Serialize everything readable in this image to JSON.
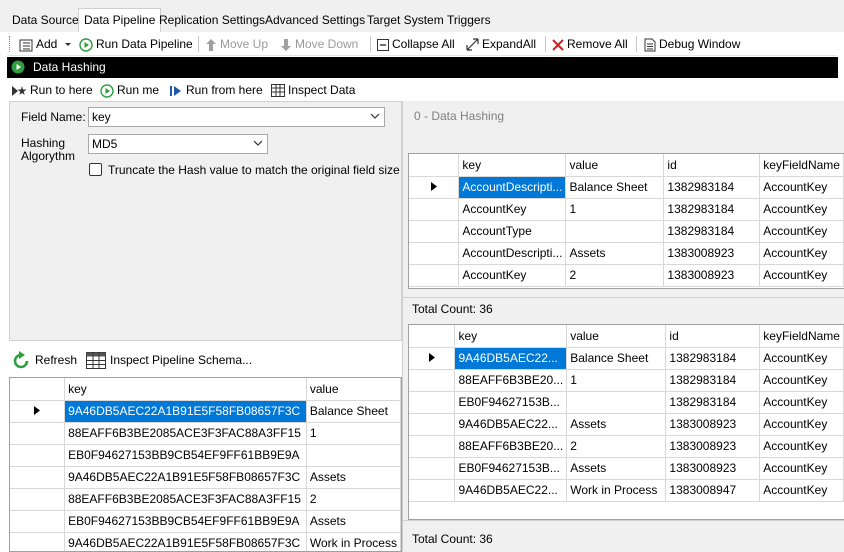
{
  "tabs": [
    {
      "label": "Data Source"
    },
    {
      "label": "Data Pipeline",
      "active": true
    },
    {
      "label": "Replication Settings"
    },
    {
      "label": "Advanced Settings"
    },
    {
      "label": "Target System"
    },
    {
      "label": "Triggers"
    }
  ],
  "toolbar": {
    "add": "Add",
    "run_pipeline": "Run Data Pipeline",
    "move_up": "Move Up",
    "move_down": "Move Down",
    "collapse_all": "Collapse All",
    "expand_all": "ExpandAll",
    "remove_all": "Remove All",
    "debug_window": "Debug Window"
  },
  "step": {
    "title": "Data Hashing"
  },
  "runbar": {
    "run_to_here": "Run to here",
    "run_me": "Run me",
    "run_from_here": "Run from here",
    "inspect_data": "Inspect Data"
  },
  "form": {
    "field_name_label": "Field Name:",
    "field_name_value": "key",
    "hashing_label_1": "Hashing",
    "hashing_label_2": "Algorythm",
    "hashing_value": "MD5",
    "truncate_label": "Truncate the Hash value to match the original field size"
  },
  "leftbar": {
    "refresh": "Refresh",
    "inspect_schema": "Inspect Pipeline Schema..."
  },
  "left_grid": {
    "columns": [
      "key",
      "value"
    ],
    "rows": [
      [
        "9A46DB5AEC22A1B91E5F58FB08657F3C",
        "Balance Sheet"
      ],
      [
        "88EAFF6B3BE2085ACE3F3FAC88A3FF15",
        "1"
      ],
      [
        "EB0F94627153BB9CB54EF9FF61BB9E9A",
        ""
      ],
      [
        "9A46DB5AEC22A1B91E5F58FB08657F3C",
        "Assets"
      ],
      [
        "88EAFF6B3BE2085ACE3F3FAC88A3FF15",
        "2"
      ],
      [
        "EB0F94627153BB9CB54EF9FF61BB9E9A",
        "Assets"
      ],
      [
        "9A46DB5AEC22A1B91E5F58FB08657F3C",
        "Work in Process"
      ]
    ]
  },
  "right": {
    "title": "0 - Data Hashing",
    "top_grid": {
      "columns": [
        "key",
        "value",
        "id",
        "keyFieldName"
      ],
      "rows": [
        [
          "AccountDescripti...",
          "Balance Sheet",
          "1382983184",
          "AccountKey"
        ],
        [
          "AccountKey",
          "1",
          "1382983184",
          "AccountKey"
        ],
        [
          "AccountType",
          "",
          "1382983184",
          "AccountKey"
        ],
        [
          "AccountDescripti...",
          "Assets",
          "1383008923",
          "AccountKey"
        ],
        [
          "AccountKey",
          "2",
          "1383008923",
          "AccountKey"
        ]
      ]
    },
    "top_total": "Total Count: 36",
    "bottom_grid": {
      "columns": [
        "key",
        "value",
        "id",
        "keyFieldName"
      ],
      "rows": [
        [
          "9A46DB5AEC22...",
          "Balance Sheet",
          "1382983184",
          "AccountKey"
        ],
        [
          "88EAFF6B3BE20...",
          "1",
          "1382983184",
          "AccountKey"
        ],
        [
          "EB0F94627153B...",
          "",
          "1382983184",
          "AccountKey"
        ],
        [
          "9A46DB5AEC22...",
          "Assets",
          "1383008923",
          "AccountKey"
        ],
        [
          "88EAFF6B3BE20...",
          "2",
          "1383008923",
          "AccountKey"
        ],
        [
          "EB0F94627153B...",
          "Assets",
          "1383008923",
          "AccountKey"
        ],
        [
          "9A46DB5AEC22...",
          "Work in Process",
          "1383008947",
          "AccountKey"
        ]
      ]
    },
    "bottom_total": "Total Count: 36"
  },
  "colors": {
    "selection": "#0078d7",
    "run_green": "#2e9e3e",
    "remove_red": "#d02020",
    "step_bar": "#000000"
  }
}
